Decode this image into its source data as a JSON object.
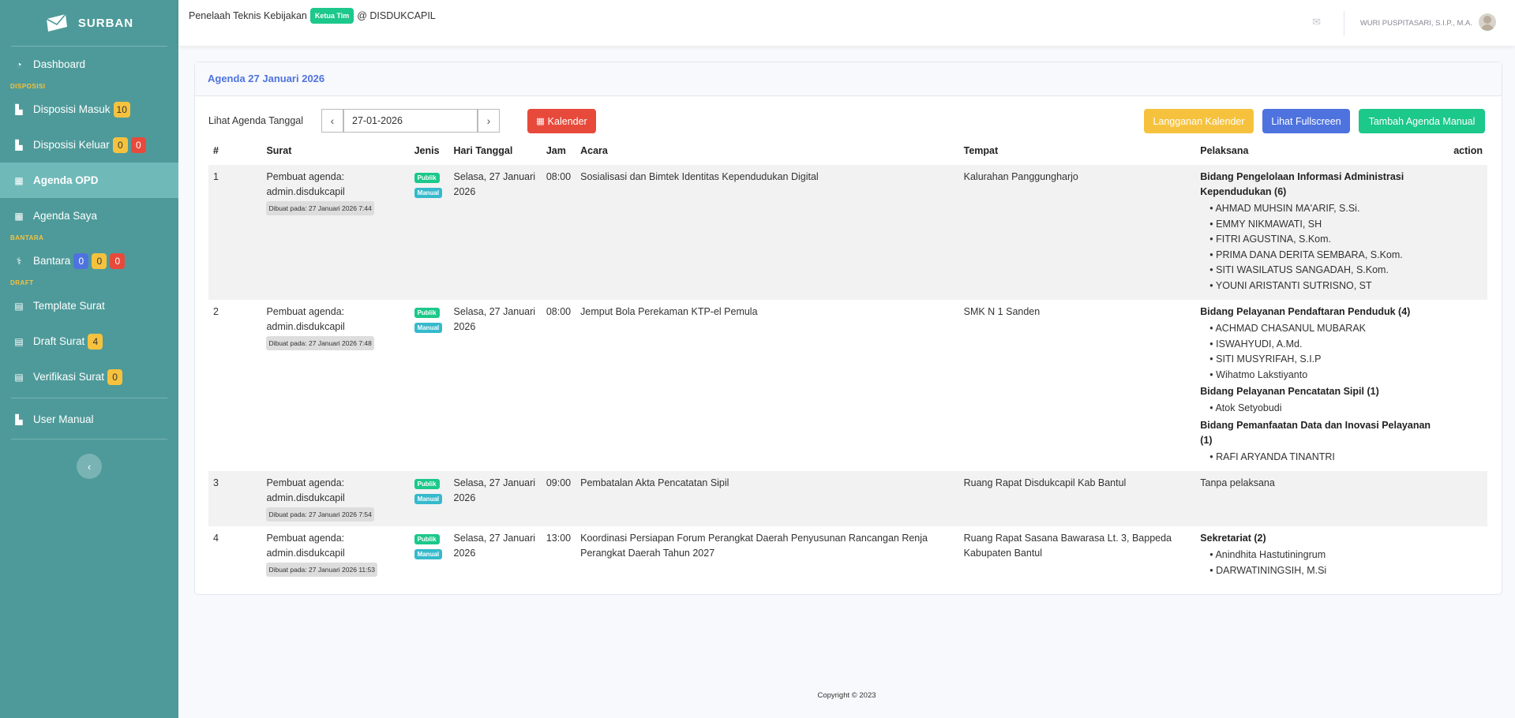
{
  "brand": {
    "name": "SURBAN"
  },
  "sidebar": {
    "items": [
      {
        "label": "Dashboard",
        "icon": "dashboard-icon"
      },
      {
        "heading": "DISPOSISI"
      },
      {
        "label": "Disposisi Masuk",
        "icon": "chart-icon",
        "badges": [
          "10"
        ]
      },
      {
        "label": "Disposisi Keluar",
        "icon": "chart-icon",
        "badges": [
          "0",
          "0"
        ]
      },
      {
        "label": "Agenda OPD",
        "icon": "calendar-icon",
        "active": true
      },
      {
        "label": "Agenda Saya",
        "icon": "calendar-icon"
      },
      {
        "heading": "BANTARA"
      },
      {
        "label": "Bantara",
        "icon": "bantara-icon",
        "badges": [
          "0",
          "0",
          "0"
        ]
      },
      {
        "heading": "DRAFT"
      },
      {
        "label": "Template Surat",
        "icon": "file-icon"
      },
      {
        "label": "Draft Surat",
        "icon": "file-icon",
        "badges": [
          "4"
        ]
      },
      {
        "label": "Verifikasi Surat",
        "icon": "file-icon",
        "badges": [
          "0"
        ]
      },
      {
        "label": "User Manual",
        "icon": "chart-icon"
      }
    ],
    "toggle_icon": "chevron-left-icon"
  },
  "topbar": {
    "role_prefix": "Penelaah Teknis Kebijakan",
    "role_badge": "Ketua Tim",
    "role_suffix": "@ DISDUKCAPIL",
    "user_name": "WURI PUSPITASARI, S.I.P., M.A."
  },
  "card": {
    "title": "Agenda 27 Januari 2026",
    "view_label": "Lihat Agenda Tanggal",
    "date_value": "27-01-2026",
    "btn_kalender": "Kalender",
    "btn_langganan": "Langganan Kalender",
    "btn_fullscreen": "Lihat Fullscreen",
    "btn_tambah": "Tambah Agenda Manual"
  },
  "table": {
    "headers": [
      "#",
      "Surat",
      "Jenis",
      "Hari Tanggal",
      "Jam",
      "Acara",
      "Tempat",
      "Pelaksana",
      "action"
    ],
    "rows": [
      {
        "no": "1",
        "surat": "Pembuat agenda: admin.disdukcapil",
        "created": "Dibuat pada: 27 Januari 2026 7:44",
        "tags": [
          "Publik",
          "Manual"
        ],
        "tanggal": "Selasa, 27 Januari 2026",
        "jam": "08:00",
        "acara": "Sosialisasi dan Bimtek Identitas Kependudukan Digital",
        "tempat": "Kalurahan Panggungharjo",
        "groups": [
          {
            "name": "Bidang Pengelolaan Informasi Administrasi Kependudukan (6)",
            "people": [
              "AHMAD MUHSIN MA'ARIF, S.Si.",
              "EMMY NIKMAWATI, SH",
              "FITRI AGUSTINA, S.Kom.",
              "PRIMA DANA DERITA SEMBARA, S.Kom.",
              "SITI WASILATUS SANGADAH, S.Kom.",
              "YOUNI ARISTANTI SUTRISNO, ST"
            ]
          }
        ]
      },
      {
        "no": "2",
        "surat": "Pembuat agenda: admin.disdukcapil",
        "created": "Dibuat pada: 27 Januari 2026 7:48",
        "tags": [
          "Publik",
          "Manual"
        ],
        "tanggal": "Selasa, 27 Januari 2026",
        "jam": "08:00",
        "acara": "Jemput Bola Perekaman KTP-el Pemula",
        "tempat": "SMK N 1 Sanden",
        "groups": [
          {
            "name": "Bidang Pelayanan Pendaftaran Penduduk (4)",
            "people": [
              "ACHMAD CHASANUL MUBARAK",
              "ISWAHYUDI, A.Md.",
              "SITI MUSYRIFAH, S.I.P",
              "Wihatmo Lakstiyanto"
            ]
          },
          {
            "name": "Bidang Pelayanan Pencatatan Sipil (1)",
            "people": [
              "Atok Setyobudi"
            ]
          },
          {
            "name": "Bidang Pemanfaatan Data dan Inovasi Pelayanan (1)",
            "people": [
              "RAFI ARYANDA TINANTRI"
            ]
          }
        ]
      },
      {
        "no": "3",
        "surat": "Pembuat agenda: admin.disdukcapil",
        "created": "Dibuat pada: 27 Januari 2026 7:54",
        "tags": [
          "Publik",
          "Manual"
        ],
        "tanggal": "Selasa, 27 Januari 2026",
        "jam": "09:00",
        "acara": "Pembatalan Akta Pencatatan Sipil",
        "tempat": "Ruang Rapat Disdukcapil Kab Bantul",
        "no_pelaksana": "Tanpa pelaksana",
        "groups": []
      },
      {
        "no": "4",
        "surat": "Pembuat agenda: admin.disdukcapil",
        "created": "Dibuat pada: 27 Januari 2026 11:53",
        "tags": [
          "Publik",
          "Manual"
        ],
        "tanggal": "Selasa, 27 Januari 2026",
        "jam": "13:00",
        "acara": "Koordinasi Persiapan Forum Perangkat Daerah Penyusunan Rancangan Renja Perangkat Daerah Tahun 2027",
        "tempat": "Ruang Rapat Sasana Bawarasa Lt. 3, Bappeda Kabupaten Bantul",
        "groups": [
          {
            "name": "Sekretariat (2)",
            "people": [
              "Anindhita Hastutiningrum",
              "DARWATININGSIH, M.Si"
            ]
          }
        ]
      }
    ]
  },
  "footer": {
    "text": "Copyright © 2023"
  },
  "colors": {
    "sidebar": "#4e9a9a",
    "active": "#6fb9b9",
    "primary": "#4e73df",
    "success": "#1cc88a",
    "warning": "#f6c23e",
    "danger": "#e74a3b",
    "info": "#36b9cc"
  }
}
